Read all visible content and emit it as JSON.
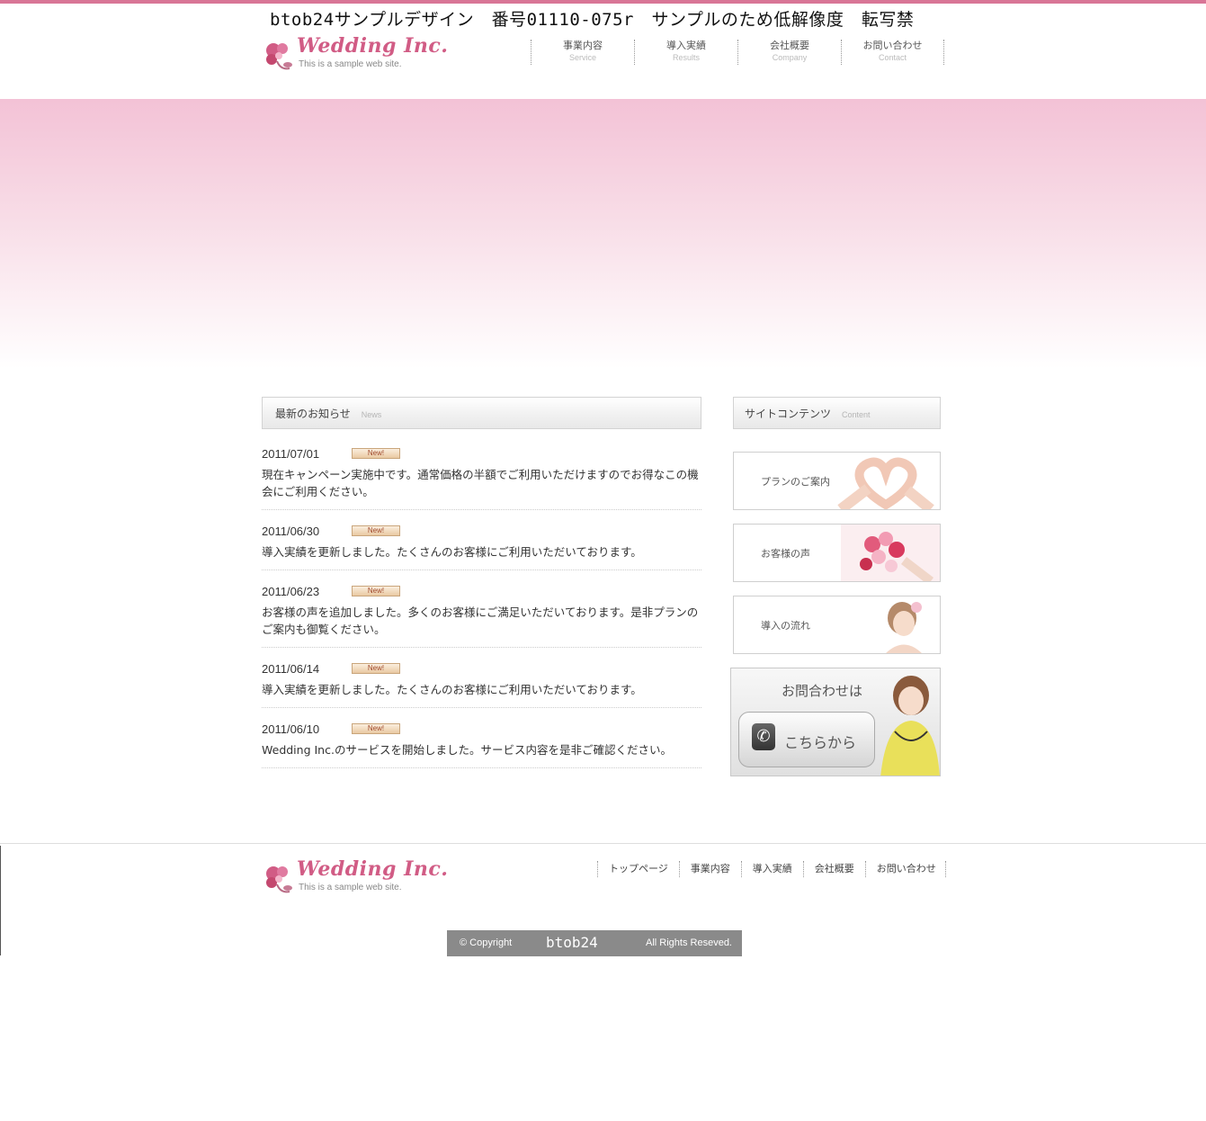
{
  "watermark": "btob24サンプルデザイン　番号01110-075r　サンプルのため低解像度　転写禁",
  "logo": {
    "name": "Wedding Inc.",
    "tagline": "This is a sample web site."
  },
  "global_nav": [
    {
      "jp": "事業内容",
      "en": "Service"
    },
    {
      "jp": "導入実績",
      "en": "Results"
    },
    {
      "jp": "会社概要",
      "en": "Company"
    },
    {
      "jp": "お問い合わせ",
      "en": "Contact"
    }
  ],
  "news": {
    "heading": "最新のお知らせ",
    "heading_en": "News",
    "badge": "New!",
    "items": [
      {
        "date": "2011/07/01",
        "text": "現在キャンペーン実施中です。通常価格の半額でご利用いただけますのでお得なこの機会にご利用ください。"
      },
      {
        "date": "2011/06/30",
        "text": "導入実績を更新しました。たくさんのお客様にご利用いただいております。"
      },
      {
        "date": "2011/06/23",
        "text": "お客様の声を追加しました。多くのお客様にご満足いただいております。是非プランのご案内も御覧ください。"
      },
      {
        "date": "2011/06/14",
        "text": "導入実績を更新しました。たくさんのお客様にご利用いただいております。"
      },
      {
        "date": "2011/06/10",
        "text": "Wedding Inc.のサービスを開始しました。サービス内容を是非ご確認ください。"
      }
    ]
  },
  "sidebar": {
    "heading": "サイトコンテンツ",
    "heading_en": "Content",
    "links": [
      {
        "label": "プランのご案内",
        "icon": "heart-hands-photo"
      },
      {
        "label": "お客様の声",
        "icon": "bouquet-photo"
      },
      {
        "label": "導入の流れ",
        "icon": "bride-photo"
      }
    ],
    "contact": {
      "title": "お問合わせは",
      "button": "こちらから",
      "icon": "phone-icon"
    }
  },
  "footer": {
    "nav": [
      "トップページ",
      "事業内容",
      "導入実績",
      "会社概要",
      "お問い合わせ"
    ],
    "copyright": {
      "prefix": "© Copyright",
      "brand": "btob24",
      "suffix": "All Rights Reseved."
    }
  },
  "colors": {
    "accent": "#d87596",
    "hero_top": "#f3c2d6",
    "logo": "#d15c85",
    "footer_bar": "#8a8a8a"
  }
}
